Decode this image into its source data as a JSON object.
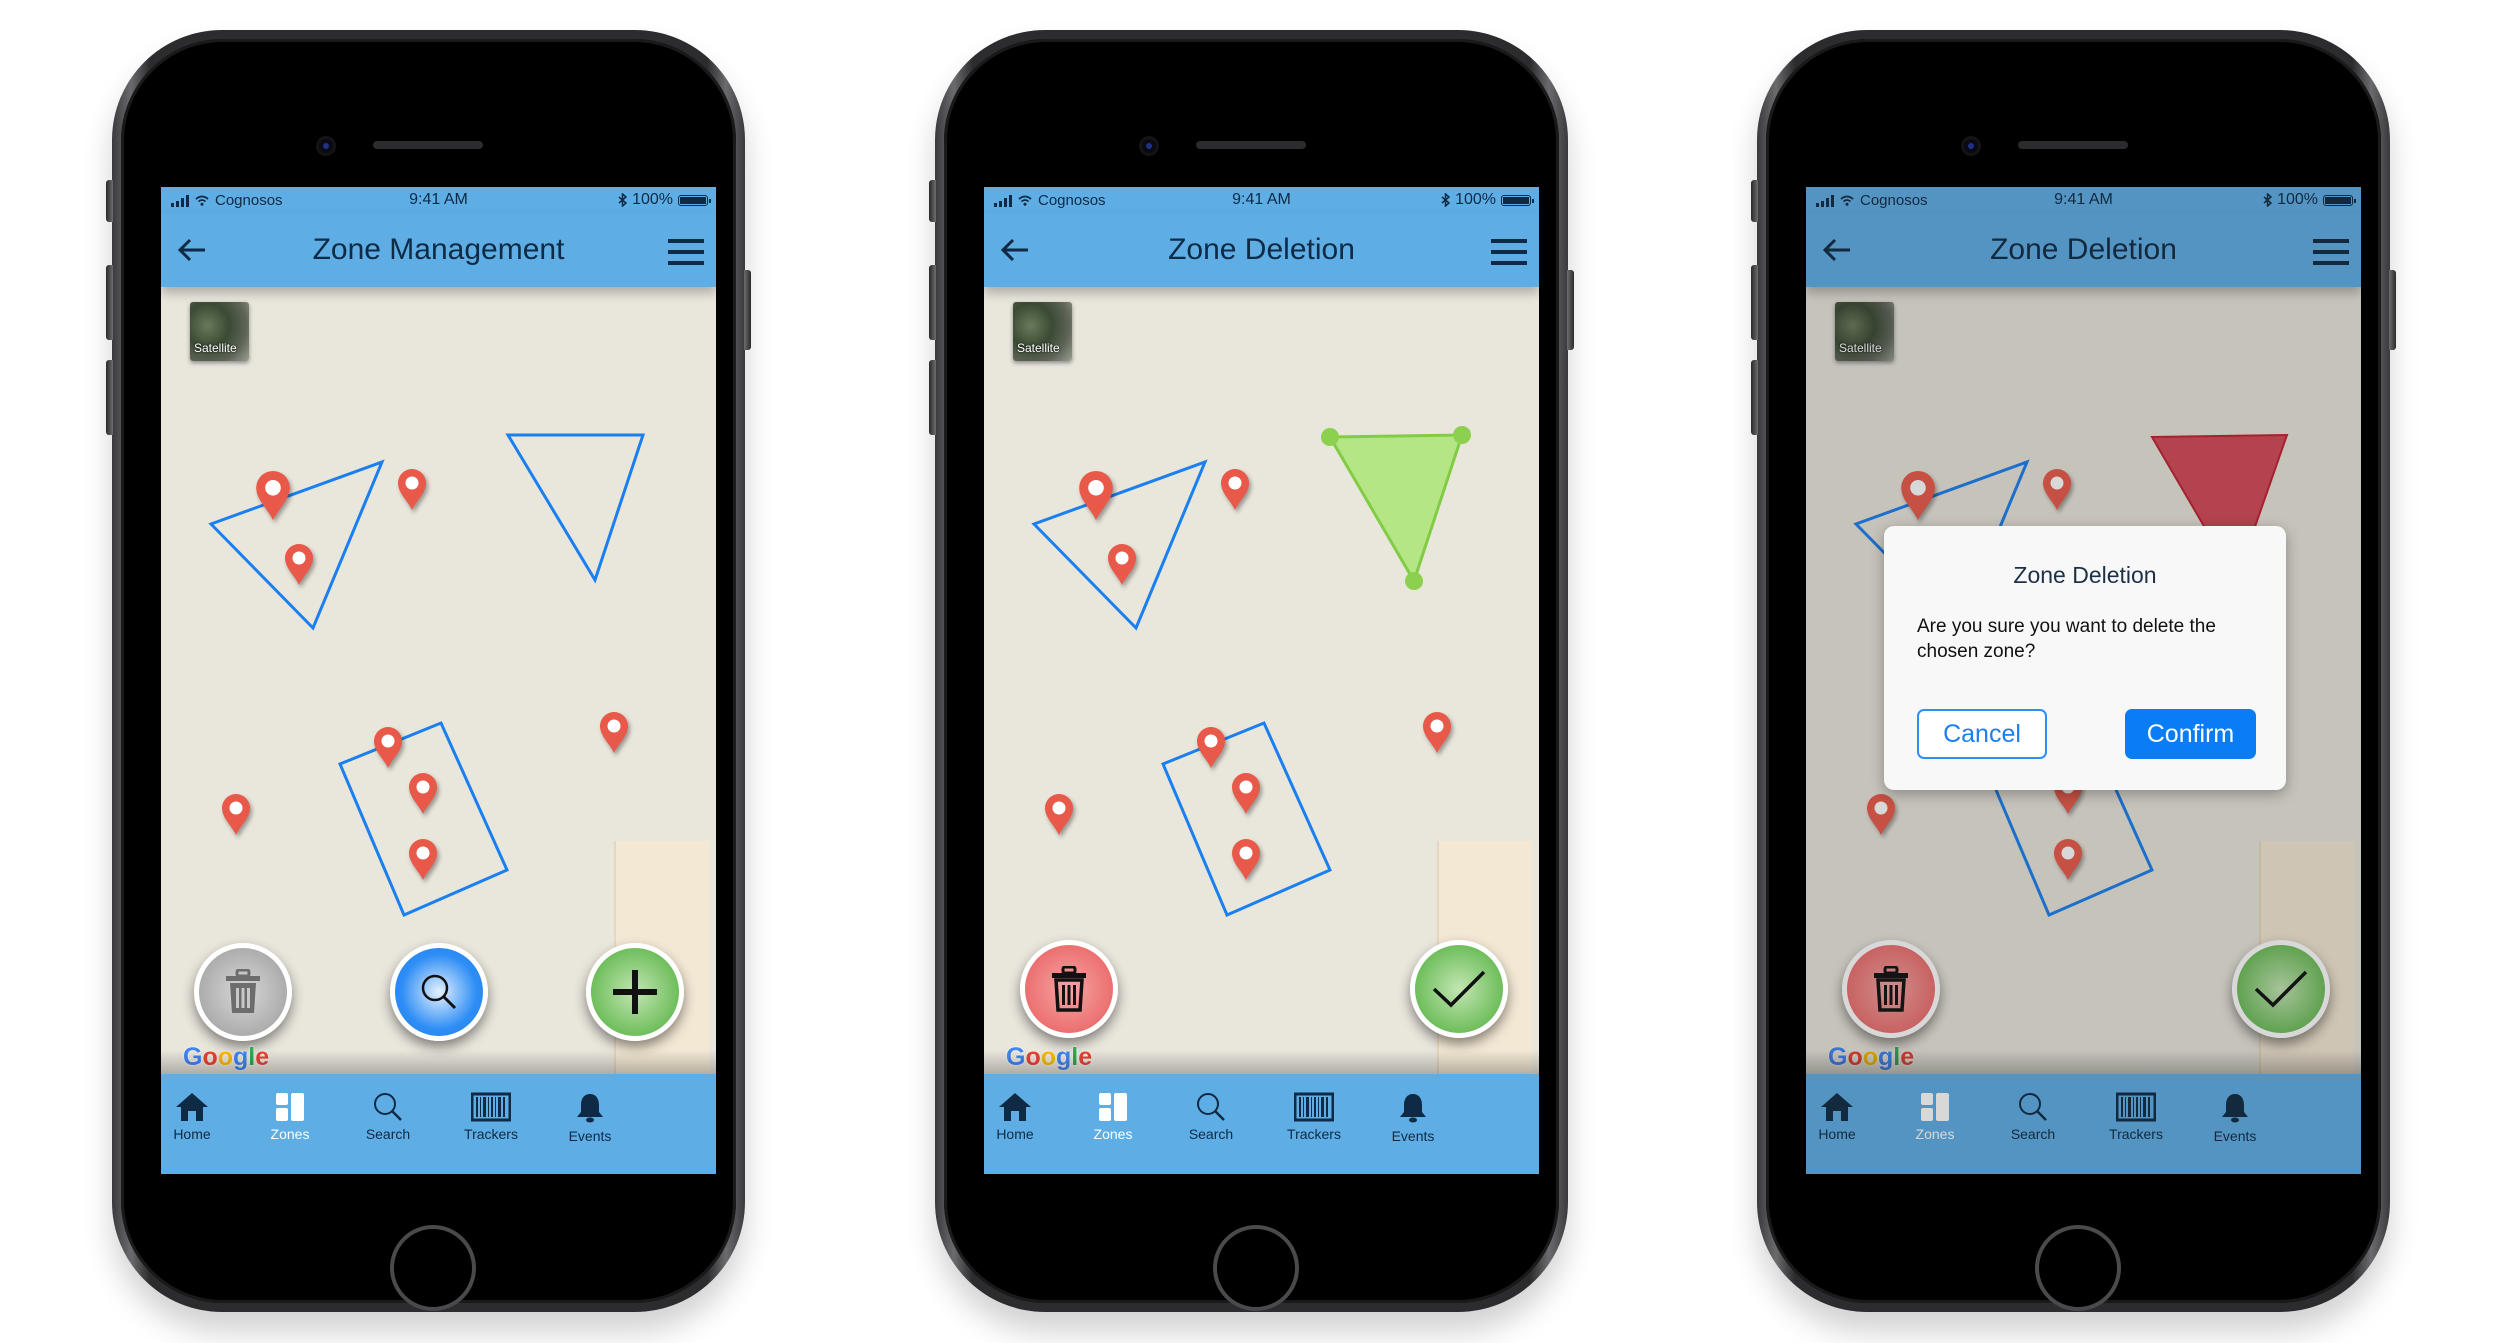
{
  "colors": {
    "header_blue": "#5eade4",
    "zone_outline": "#1a7ff0",
    "selected_zone_fill": "#b5e685",
    "delete_zone_fill": "#b94a55",
    "pin_red": "#e8594a",
    "confirm_blue": "#0a7cf5",
    "map_bg": "#e9e6dc"
  },
  "status_bar": {
    "carrier": "Cognosos",
    "time": "9:41 AM",
    "battery": "100%",
    "icons": [
      "signal-icon",
      "wifi-icon",
      "bluetooth-icon",
      "battery-icon"
    ]
  },
  "tabs": [
    {
      "label": "Home",
      "icon": "home-icon"
    },
    {
      "label": "Zones",
      "icon": "zones-icon"
    },
    {
      "label": "Search",
      "icon": "search-icon"
    },
    {
      "label": "Trackers",
      "icon": "barcode-icon"
    },
    {
      "label": "Events",
      "icon": "bell-icon"
    }
  ],
  "active_tab": "Zones",
  "map": {
    "satellite_label": "Satellite",
    "attribution": "Google"
  },
  "screens": [
    {
      "title": "Zone Management",
      "actions": [
        {
          "name": "delete-zone-button",
          "icon": "trash-icon",
          "color": "gray"
        },
        {
          "name": "search-zone-button",
          "icon": "magnifier-icon",
          "color": "blue"
        },
        {
          "name": "add-zone-button",
          "icon": "plus-icon",
          "color": "green"
        }
      ],
      "selected_zone": "none"
    },
    {
      "title": "Zone Deletion",
      "actions": [
        {
          "name": "delete-zone-button",
          "icon": "trash-icon",
          "color": "red"
        },
        {
          "name": "confirm-selection-button",
          "icon": "check-icon",
          "color": "green"
        }
      ],
      "selected_zone": "triangle-2 (highlighted green)"
    },
    {
      "title": "Zone Deletion",
      "actions": [
        {
          "name": "delete-zone-button",
          "icon": "trash-icon",
          "color": "red"
        },
        {
          "name": "confirm-selection-button",
          "icon": "check-icon",
          "color": "green"
        }
      ],
      "selected_zone": "triangle-2 (marked red for deletion)",
      "dialog": {
        "title": "Zone Deletion",
        "message": "Are you sure you want to delete the chosen zone?",
        "cancel_label": "Cancel",
        "confirm_label": "Confirm"
      }
    }
  ]
}
